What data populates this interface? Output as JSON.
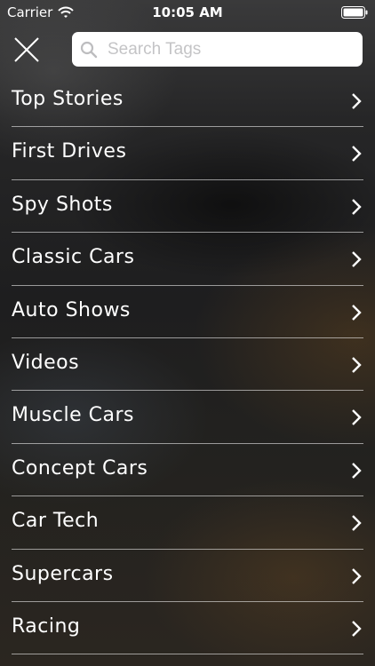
{
  "status_bar": {
    "carrier": "Carrier",
    "time": "10:05 AM",
    "wifi_icon": "wifi-icon",
    "battery_icon": "battery-full-icon"
  },
  "header": {
    "close_icon": "close-icon",
    "search": {
      "placeholder": "Search Tags",
      "value": "",
      "icon": "search-icon"
    }
  },
  "tags": [
    {
      "label": "Top Stories",
      "icon": "chevron-right-icon"
    },
    {
      "label": "First Drives",
      "icon": "chevron-right-icon"
    },
    {
      "label": "Spy Shots",
      "icon": "chevron-right-icon"
    },
    {
      "label": "Classic Cars",
      "icon": "chevron-right-icon"
    },
    {
      "label": "Auto Shows",
      "icon": "chevron-right-icon"
    },
    {
      "label": "Videos",
      "icon": "chevron-right-icon"
    },
    {
      "label": "Muscle Cars",
      "icon": "chevron-right-icon"
    },
    {
      "label": "Concept Cars",
      "icon": "chevron-right-icon"
    },
    {
      "label": "Car Tech",
      "icon": "chevron-right-icon"
    },
    {
      "label": "Supercars",
      "icon": "chevron-right-icon"
    },
    {
      "label": "Racing",
      "icon": "chevron-right-icon"
    }
  ],
  "colors": {
    "text": "#ffffff",
    "divider": "#ffffff",
    "search_background": "#ffffff",
    "placeholder": "#c4c4c6"
  }
}
